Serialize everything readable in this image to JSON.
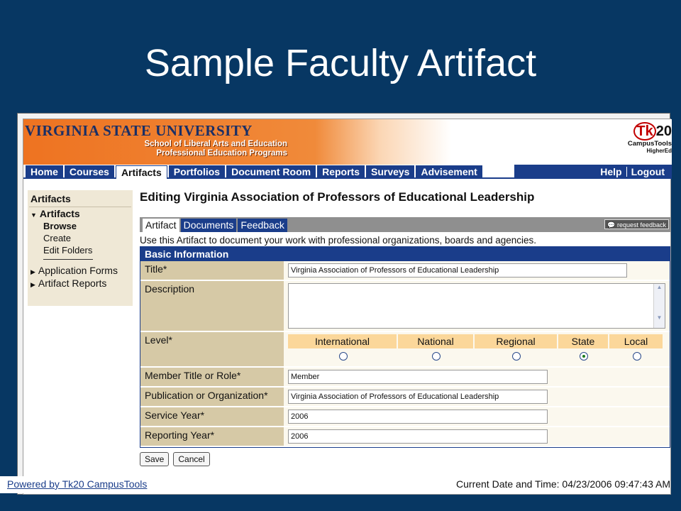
{
  "slide": {
    "title": "Sample Faculty Artifact"
  },
  "banner": {
    "university": "VIRGINIA STATE UNIVERSITY",
    "school_line1": "School of Liberal Arts and Education",
    "school_line2": "Professional Education Programs",
    "logo_tk": "Tk",
    "logo_num": "20",
    "logo_line1": "CampusTools",
    "logo_line2": "HigherEd"
  },
  "nav": {
    "tabs": [
      {
        "label": "Home"
      },
      {
        "label": "Courses"
      },
      {
        "label": "Artifacts"
      },
      {
        "label": "Portfolios"
      },
      {
        "label": "Document Room"
      },
      {
        "label": "Reports"
      },
      {
        "label": "Surveys"
      },
      {
        "label": "Advisement"
      }
    ],
    "help": "Help",
    "logout": "Logout"
  },
  "sidebar": {
    "header": "Artifacts",
    "section": "Artifacts",
    "items": [
      {
        "label": "Browse"
      },
      {
        "label": "Create"
      },
      {
        "label": "Edit Folders"
      }
    ],
    "application_forms": "Application Forms",
    "artifact_reports": "Artifact Reports"
  },
  "main": {
    "heading": "Editing Virginia Association of Professors of Educational Leadership",
    "subtabs": [
      {
        "label": "Artifact"
      },
      {
        "label": "Documents"
      },
      {
        "label": "Feedback"
      }
    ],
    "request_feedback": "request feedback",
    "intro": "Use this Artifact to document your work with professional organizations, boards and agencies.",
    "panel_title": "Basic Information"
  },
  "form": {
    "title_label": "Title*",
    "title_value": "Virginia Association of Professors of Educational Leadership",
    "description_label": "Description",
    "description_value": "",
    "level_label": "Level*",
    "levels": [
      {
        "label": "International",
        "selected": false
      },
      {
        "label": "National",
        "selected": false
      },
      {
        "label": "Regional",
        "selected": false
      },
      {
        "label": "State",
        "selected": true
      },
      {
        "label": "Local",
        "selected": false
      }
    ],
    "member_label": "Member Title or Role*",
    "member_value": "Member",
    "publication_label": "Publication or Organization*",
    "publication_value": "Virginia Association of Professors of Educational Leadership",
    "service_label": "Service Year*",
    "service_value": "2006",
    "reporting_label": "Reporting Year*",
    "reporting_value": "2006"
  },
  "buttons": {
    "save": "Save",
    "cancel": "Cancel"
  },
  "footer": {
    "powered": "Powered by Tk20 CampusTools",
    "datetime": "Current Date and Time: 04/23/2006 09:47:43 AM"
  },
  "colors": {
    "navy": "#1a3d8a",
    "slide_bg": "#073763",
    "orange": "#ee7321",
    "tan": "#d6c9a6"
  }
}
